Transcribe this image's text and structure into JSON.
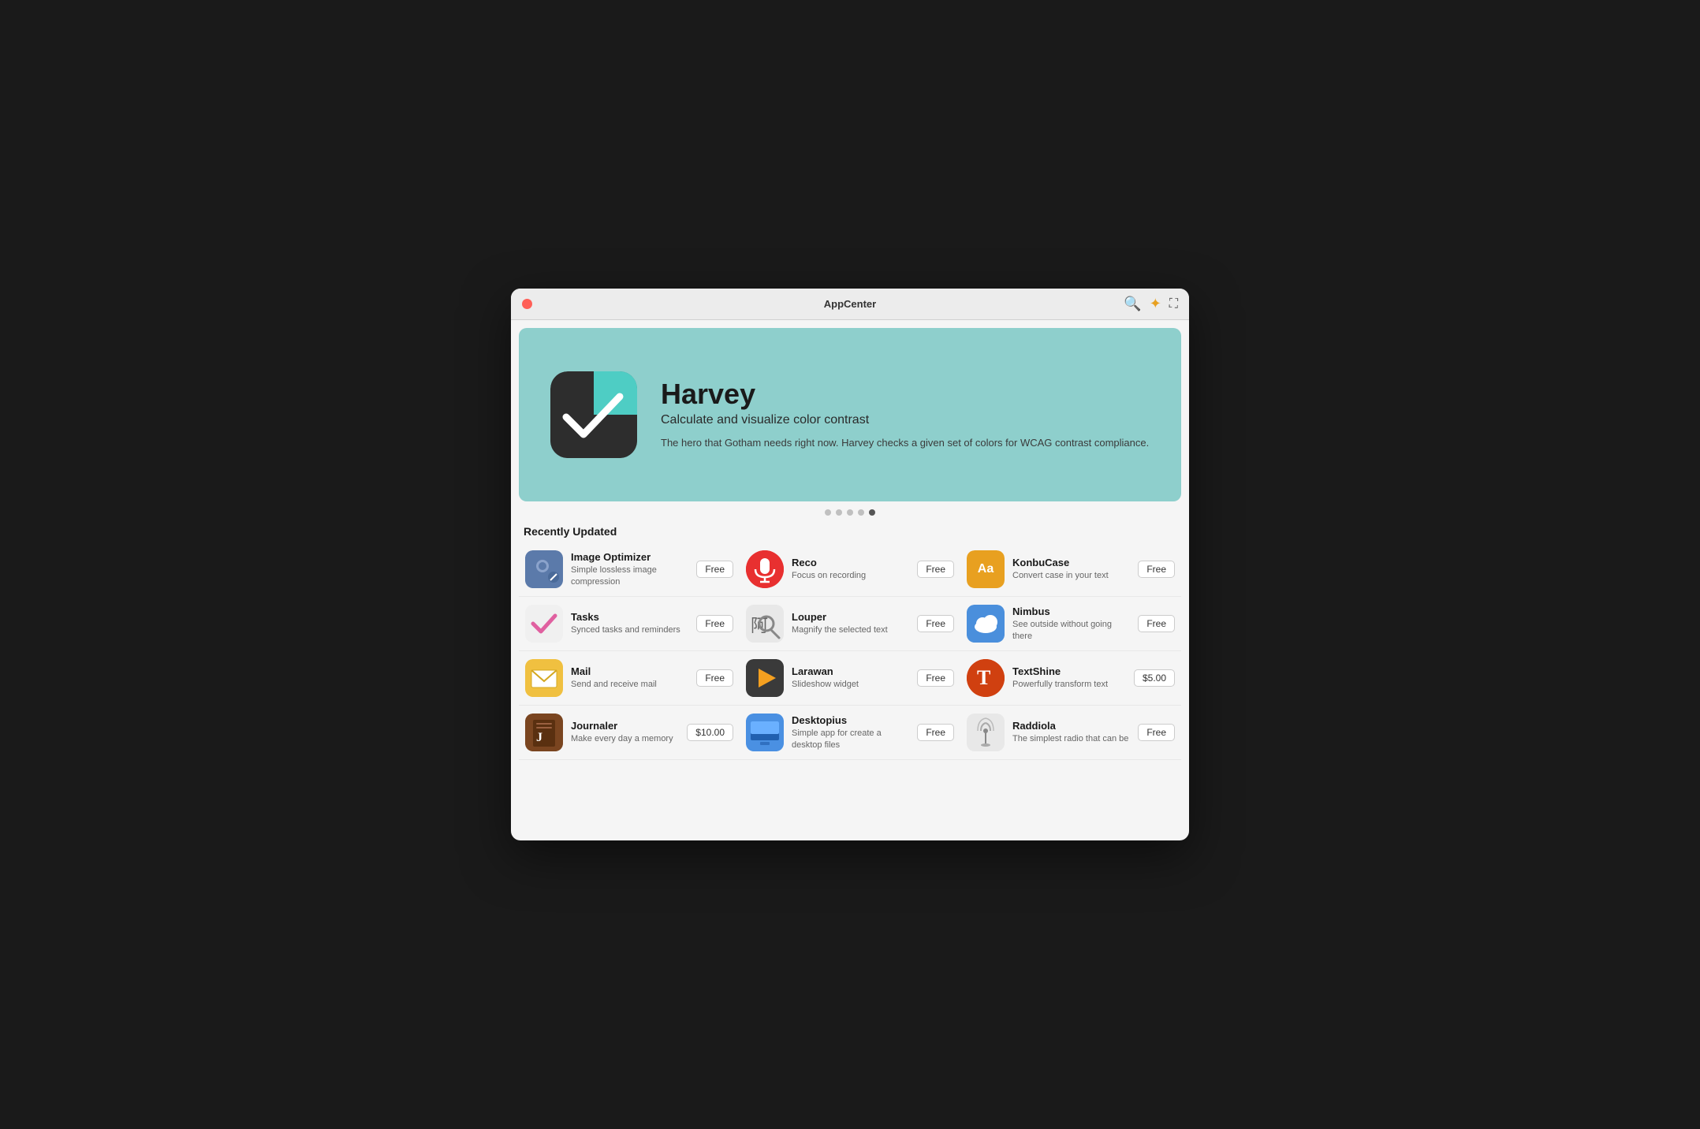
{
  "window": {
    "title": "AppCenter"
  },
  "hero": {
    "app_name": "Harvey",
    "tagline": "Calculate and visualize color contrast",
    "description": "The hero that Gotham needs right now. Harvey checks a given set of colors for WCAG contrast compliance."
  },
  "dots": [
    {
      "active": false
    },
    {
      "active": false
    },
    {
      "active": false
    },
    {
      "active": false
    },
    {
      "active": true
    }
  ],
  "section": {
    "title": "Recently Updated"
  },
  "apps": [
    {
      "id": "image-optimizer",
      "name": "Image Optimizer",
      "desc": "Simple lossless image compression",
      "price": "Free",
      "icon_char": "🖼"
    },
    {
      "id": "reco",
      "name": "Reco",
      "desc": "Focus on recording",
      "price": "Free",
      "icon_char": "🎙"
    },
    {
      "id": "konbucase",
      "name": "KonbuCase",
      "desc": "Convert case in your text",
      "price": "Free",
      "icon_char": "Aa"
    },
    {
      "id": "tasks",
      "name": "Tasks",
      "desc": "Synced tasks and reminders",
      "price": "Free",
      "icon_char": "✓"
    },
    {
      "id": "louper",
      "name": "Louper",
      "desc": "Magnify the selected text",
      "price": "Free",
      "icon_char": "🔍"
    },
    {
      "id": "nimbus",
      "name": "Nimbus",
      "desc": "See outside without going there",
      "price": "Free",
      "icon_char": "☁"
    },
    {
      "id": "mail",
      "name": "Mail",
      "desc": "Send and receive mail",
      "price": "Free",
      "icon_char": "✉"
    },
    {
      "id": "larawan",
      "name": "Larawan",
      "desc": "Slideshow widget",
      "price": "Free",
      "icon_char": "▶"
    },
    {
      "id": "textshine",
      "name": "TextShine",
      "desc": "Powerfully transform text",
      "price": "$5.00",
      "icon_char": "T"
    },
    {
      "id": "journaler",
      "name": "Journaler",
      "desc": "Make every day a memory",
      "price": "$10.00",
      "icon_char": "J"
    },
    {
      "id": "desktopius",
      "name": "Desktopius",
      "desc": "Simple app for create a desktop files",
      "price": "Free",
      "icon_char": "🖥"
    },
    {
      "id": "raddiola",
      "name": "Raddiola",
      "desc": "The simplest radio that can be",
      "price": "Free",
      "icon_char": "📻"
    }
  ],
  "icons": {
    "search": "🔍",
    "gear": "⚙",
    "expand": "⛶",
    "close": "×"
  }
}
